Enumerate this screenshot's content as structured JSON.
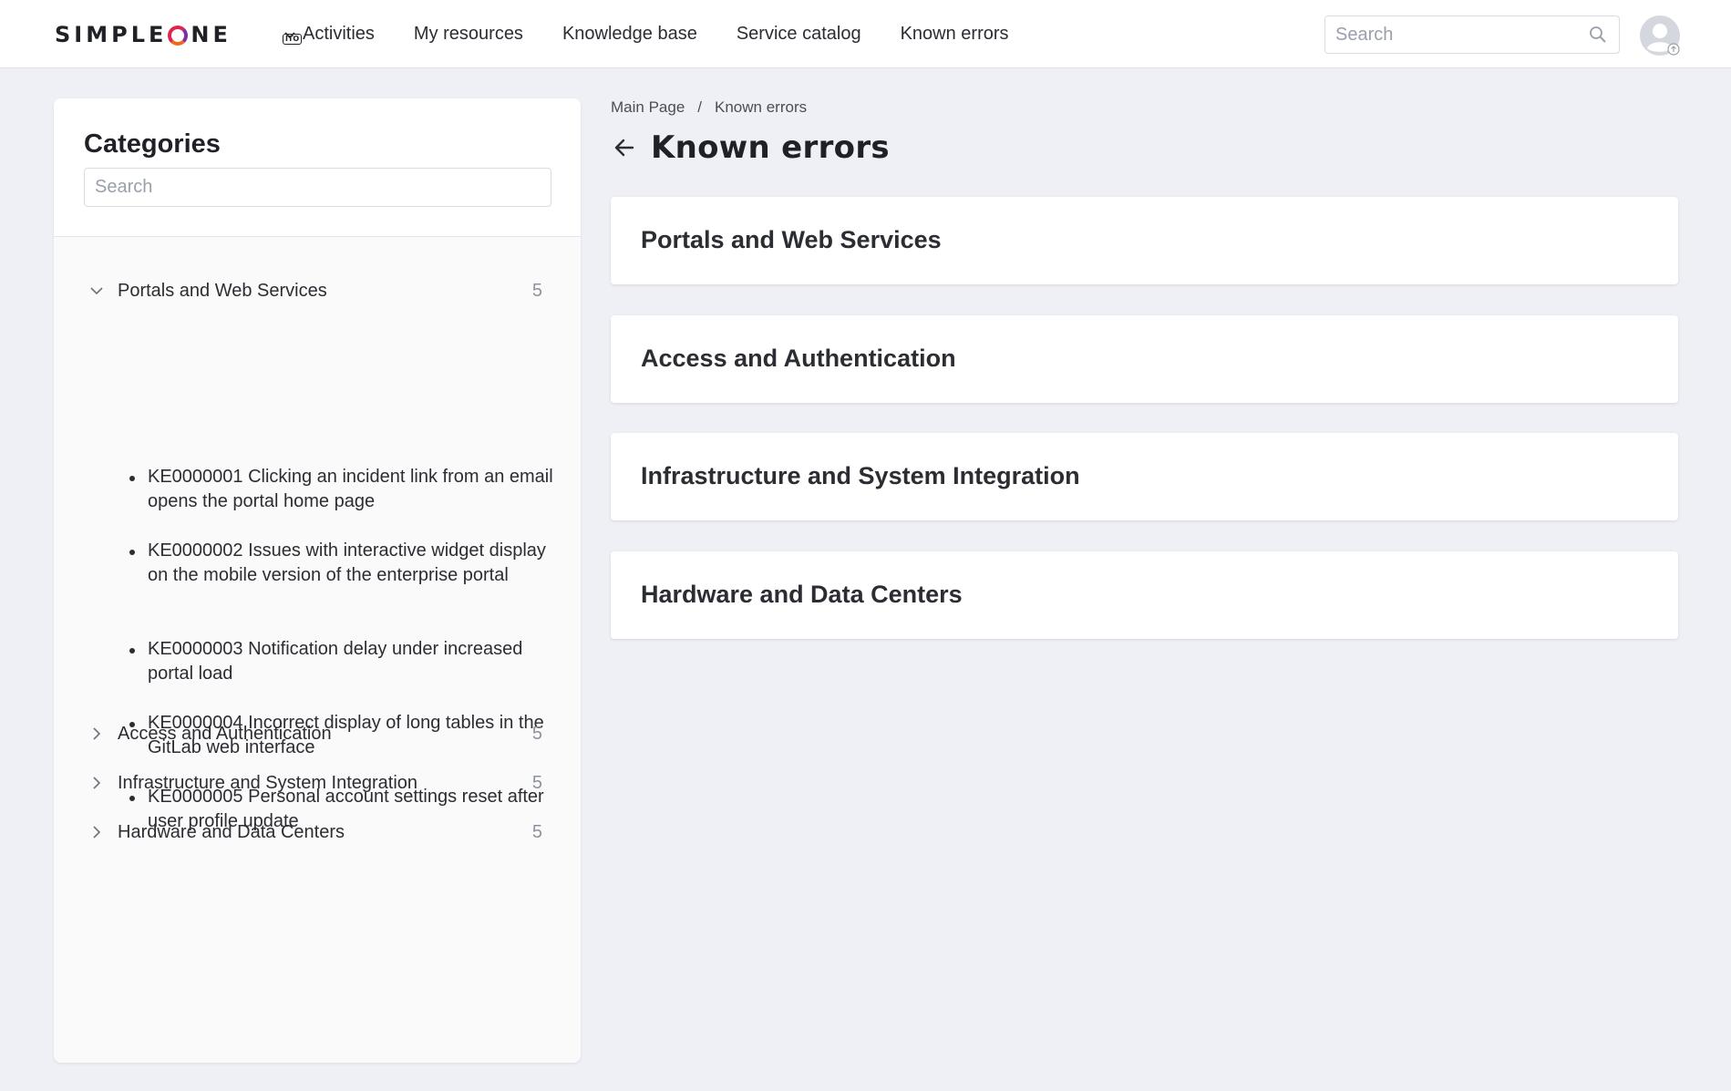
{
  "header": {
    "logo_text_a": "SIMPLE",
    "logo_text_b": "NE",
    "logo_badge": "ITO",
    "nav": [
      {
        "label": "Activities",
        "icon": "chevron-down-icon"
      },
      {
        "label": "My resources"
      },
      {
        "label": "Knowledge base"
      },
      {
        "label": "Service catalog"
      },
      {
        "label": "Known errors"
      }
    ],
    "search_placeholder": "Search"
  },
  "sidebar": {
    "title": "Categories",
    "search_placeholder": "Search",
    "categories": [
      {
        "label": "Portals and Web Services",
        "count": "5",
        "expanded": true,
        "items": [
          "KE0000001 Clicking an incident link from an email opens the portal home page",
          "KE0000002 Issues with interactive widget display on the mobile version of the enterprise portal",
          "KE0000003 Notification delay under increased portal load",
          "KE0000004 Incorrect display of long tables in the GitLab web interface",
          "KE0000005 Personal account settings reset after user profile update"
        ]
      },
      {
        "label": "Access and Authentication",
        "count": "5",
        "expanded": false
      },
      {
        "label": "Infrastructure and System Integration",
        "count": "5",
        "expanded": false
      },
      {
        "label": "Hardware and Data Centers",
        "count": "5",
        "expanded": false
      }
    ]
  },
  "main": {
    "breadcrumb": [
      "Main Page",
      "Known errors"
    ],
    "breadcrumb_sep": "/",
    "title": "Known errors",
    "cards": [
      "Portals and Web Services",
      "Access and Authentication",
      "Infrastructure and System Integration",
      "Hardware and Data Centers"
    ]
  },
  "colors": {
    "background": "#eef0f5",
    "accent_logo": "#e2234f",
    "text": "#2b2d33"
  }
}
